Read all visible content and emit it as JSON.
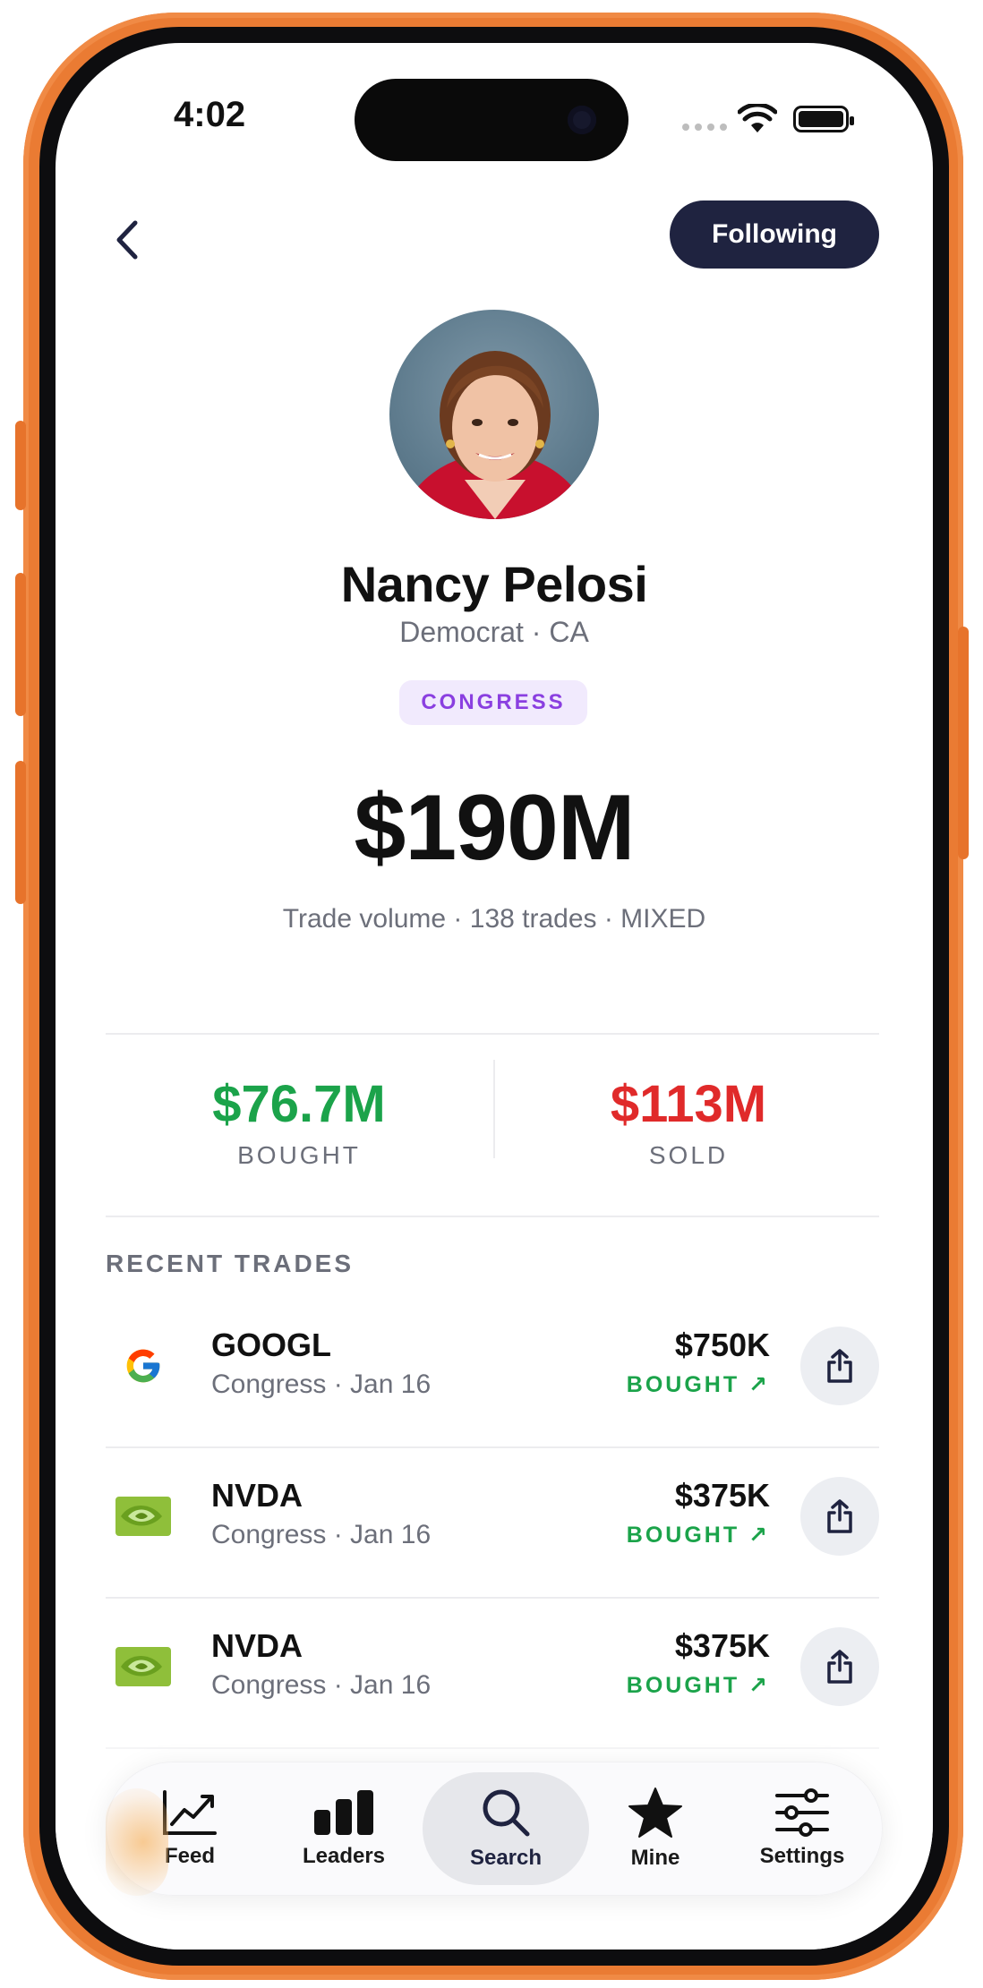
{
  "status_bar": {
    "time": "4:02"
  },
  "header": {
    "follow_label": "Following"
  },
  "profile": {
    "name": "Nancy Pelosi",
    "subtitle": "Democrat · CA",
    "badge": "CONGRESS",
    "volume": "$190M",
    "volume_caption": "Trade volume · 138 trades · MIXED"
  },
  "stats": {
    "bought": {
      "value": "$76.7M",
      "label": "BOUGHT",
      "color": "#1ba34a"
    },
    "sold": {
      "value": "$113M",
      "label": "SOLD",
      "color": "#e02a2a"
    }
  },
  "recent_trades": {
    "title": "RECENT TRADES",
    "items": [
      {
        "ticker": "GOOGL",
        "meta": "Congress · Jan 16",
        "amount": "$750K",
        "action": "BOUGHT ↗",
        "logo": "google-logo"
      },
      {
        "ticker": "NVDA",
        "meta": "Congress · Jan 16",
        "amount": "$375K",
        "action": "BOUGHT ↗",
        "logo": "nvidia-logo"
      },
      {
        "ticker": "NVDA",
        "meta": "Congress · Jan 16",
        "amount": "$375K",
        "action": "BOUGHT ↗",
        "logo": "nvidia-logo"
      }
    ]
  },
  "tabbar": {
    "tabs": [
      {
        "label": "Feed",
        "icon": "chart-line-icon"
      },
      {
        "label": "Leaders",
        "icon": "bar-chart-icon"
      },
      {
        "label": "Search",
        "icon": "search-icon",
        "active": true
      },
      {
        "label": "Mine",
        "icon": "star-icon"
      },
      {
        "label": "Settings",
        "icon": "sliders-icon"
      }
    ]
  },
  "colors": {
    "accent_dark": "#1f2340",
    "badge_purple": "#8a3fe0",
    "frame_orange": "#ea7b33"
  }
}
